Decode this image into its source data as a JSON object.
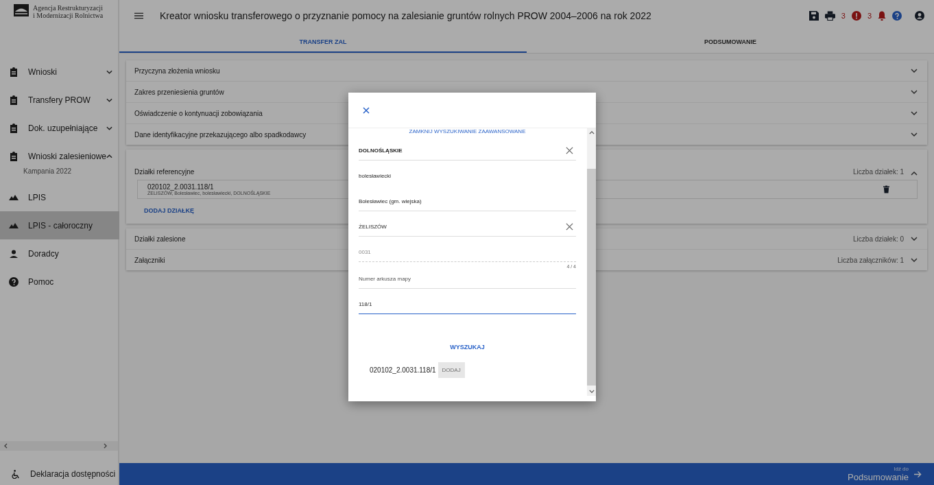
{
  "logo": {
    "line_1": "Agencja Restrukturyzacji",
    "line_2": "i Modernizacji Rolnictwa"
  },
  "sidebar": {
    "items": [
      {
        "kind": "document",
        "label": "Wnioski",
        "expandable": true,
        "expanded": false,
        "selected": false
      },
      {
        "kind": "document",
        "label": "Transfery PROW",
        "expandable": true,
        "expanded": false,
        "selected": false
      },
      {
        "kind": "document",
        "label": "Dok. uzupełniające",
        "expandable": true,
        "expanded": false,
        "selected": false
      },
      {
        "kind": "document",
        "label": "Wnioski zalesieniowe",
        "expandable": true,
        "expanded": true,
        "selected": false,
        "children": [
          {
            "label": "Kampania 2022"
          }
        ]
      },
      {
        "kind": "map",
        "label": "LPIS",
        "expandable": false,
        "selected": false
      },
      {
        "kind": "map",
        "label": "LPIS - całoroczny",
        "expandable": false,
        "selected": true
      },
      {
        "kind": "person",
        "label": "Doradcy",
        "expandable": false,
        "selected": false
      },
      {
        "kind": "help",
        "label": "Pomoc",
        "expandable": false,
        "selected": false
      }
    ],
    "footer": "Deklaracja dostępności"
  },
  "header": {
    "title": "Kreator wniosku transferowego o przyznanie pomocy na zalesianie gruntów rolnych PROW 2004–2006 na rok 2022",
    "error_count": "3",
    "notification_count": "3"
  },
  "tabs": [
    {
      "label": "TRANSFER ZAL",
      "selected": true
    },
    {
      "label": "PODSUMOWANIE",
      "selected": false
    }
  ],
  "section_groups": [
    {
      "sections": [
        {
          "title": "Przyczyna złożenia wniosku",
          "expanded": false
        },
        {
          "title": "Zakres przeniesienia gruntów",
          "expanded": false
        },
        {
          "title": "Oświadczenie o kontynuacji zobowiązania",
          "expanded": false
        },
        {
          "title": "Dane identyfikacyjne przekazującego albo spadkodawcy",
          "expanded": false
        }
      ]
    },
    {
      "sections": [
        {
          "title": "Działki referencyjne",
          "count": "Liczba działek: 1",
          "expanded": true,
          "parcels": [
            {
              "id": "020102_2.0031.118/1",
              "location": "ŻELISZÓW, Bolesławiec, bolesławiecki, DOLNOŚLĄSKIE"
            }
          ],
          "add_button": "DODAJ DZIAŁKĘ"
        }
      ]
    },
    {
      "sections": [
        {
          "title": "Działki zalesione",
          "count": "Liczba działek: 0",
          "expanded": false
        },
        {
          "title": "Załączniki",
          "count": "Liczba załączników: 1",
          "expanded": false
        }
      ]
    }
  ],
  "modal": {
    "toggle_link": "ZAMKNIJ WYSZUKIWANIE ZAAWANSOWANE",
    "fields": [
      {
        "kind": "select",
        "value": "DOLNOŚLĄSKIE",
        "clearable": true,
        "disabled": false,
        "focused": false
      },
      {
        "kind": "static",
        "value": "bolesławiecki",
        "clearable": false,
        "disabled": false,
        "focused": false
      },
      {
        "kind": "select",
        "value": "Bolesławiec (gm. wiejska)",
        "clearable": false,
        "disabled": false,
        "focused": false
      },
      {
        "kind": "select",
        "value": "ŻELISZÓW",
        "clearable": true,
        "disabled": false,
        "focused": false
      },
      {
        "kind": "input",
        "value": "0031",
        "counter": "4 / 4",
        "clearable": false,
        "disabled": true,
        "focused": false
      },
      {
        "kind": "input",
        "placeholder": "Numer arkusza mapy",
        "clearable": false,
        "disabled": false,
        "focused": false
      },
      {
        "kind": "input",
        "value": "118/1",
        "clearable": false,
        "disabled": false,
        "focused": true
      }
    ],
    "search_button": "WYSZUKAJ",
    "result": {
      "id": "020102_2.0031.118/1",
      "add_button": "DODAJ",
      "add_disabled": true
    }
  },
  "bottom_bar": {
    "caption": "Idź do",
    "target": "Podsumowanie"
  }
}
